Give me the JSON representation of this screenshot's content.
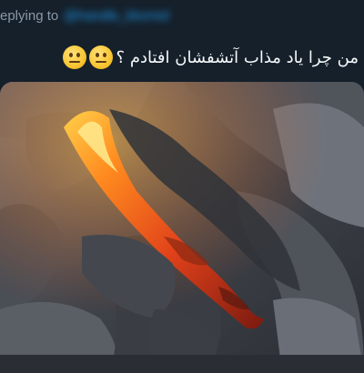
{
  "reply": {
    "prefix": "eplying to",
    "handle": "@handle_blurred"
  },
  "tweet": {
    "text": "من چرا یاد مذاب آتشفشان افتادم ؟",
    "emoji": [
      "neutral-face-emoji",
      "neutral-face-emoji"
    ]
  },
  "media": {
    "subject": "lava-photo"
  },
  "colors": {
    "background": "#15202b",
    "text": "#f7f9f9",
    "muted": "#8b98a5",
    "accent": "#1d9bf0"
  }
}
